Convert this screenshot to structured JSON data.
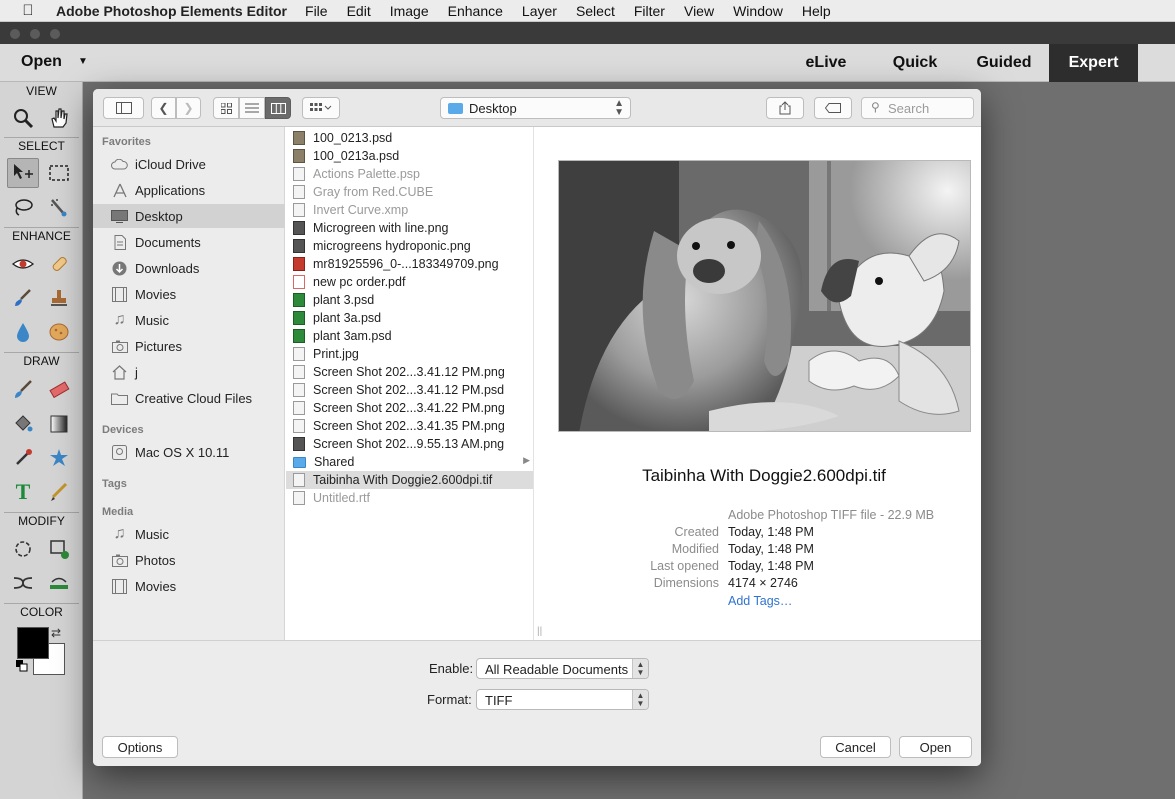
{
  "menubar": {
    "apple_icon": "apple-logo-icon",
    "app_name": "Adobe Photoshop Elements Editor",
    "items": [
      "File",
      "Edit",
      "Image",
      "Enhance",
      "Layer",
      "Select",
      "Filter",
      "View",
      "Window",
      "Help"
    ]
  },
  "appbar": {
    "open_label": "Open",
    "modes": [
      "eLive",
      "Quick",
      "Guided",
      "Expert"
    ],
    "active_mode": "Expert"
  },
  "toolbox": {
    "sections": [
      "VIEW",
      "SELECT",
      "ENHANCE",
      "DRAW",
      "MODIFY",
      "COLOR"
    ],
    "foreground_color": "#000000",
    "background_color": "#ffffff",
    "tools": {
      "view": [
        "zoom-tool-icon",
        "hand-tool-icon"
      ],
      "select": [
        "move-tool-icon",
        "marquee-tool-icon",
        "lasso-tool-icon",
        "quick-selection-tool-icon"
      ],
      "enhance": [
        "red-eye-tool-icon",
        "spot-healing-tool-icon",
        "smart-brush-tool-icon",
        "clone-stamp-tool-icon",
        "blur-tool-icon",
        "sponge-tool-icon"
      ],
      "draw": [
        "brush-tool-icon",
        "eraser-tool-icon",
        "paint-bucket-tool-icon",
        "gradient-tool-icon",
        "eyedropper-tool-icon",
        "custom-shape-tool-icon",
        "type-tool-icon",
        "pencil-tool-icon"
      ],
      "modify": [
        "crop-tool-icon",
        "recompose-tool-icon",
        "content-aware-move-tool-icon",
        "straighten-tool-icon"
      ]
    }
  },
  "dialog": {
    "location": "Desktop",
    "search_placeholder": "Search",
    "sidebar": {
      "sections": [
        {
          "heading": "Favorites",
          "items": [
            {
              "label": "iCloud Drive",
              "icon": "cloud-icon"
            },
            {
              "label": "Applications",
              "icon": "applications-icon"
            },
            {
              "label": "Desktop",
              "icon": "desktop-icon",
              "selected": true
            },
            {
              "label": "Documents",
              "icon": "documents-icon"
            },
            {
              "label": "Downloads",
              "icon": "downloads-icon"
            },
            {
              "label": "Movies",
              "icon": "movies-icon"
            },
            {
              "label": "Music",
              "icon": "music-icon"
            },
            {
              "label": "Pictures",
              "icon": "pictures-icon"
            },
            {
              "label": "j",
              "icon": "home-icon"
            },
            {
              "label": "Creative Cloud Files",
              "icon": "folder-icon"
            }
          ]
        },
        {
          "heading": "Devices",
          "items": [
            {
              "label": "Mac OS X 10.11",
              "icon": "disk-icon"
            }
          ]
        },
        {
          "heading": "Tags",
          "items": []
        },
        {
          "heading": "Media",
          "items": [
            {
              "label": "Music",
              "icon": "music-icon"
            },
            {
              "label": "Photos",
              "icon": "photos-icon"
            },
            {
              "label": "Movies",
              "icon": "movies-icon"
            }
          ]
        }
      ]
    },
    "files": [
      {
        "name": "100_0213.psd",
        "kind": "photo",
        "dim": false
      },
      {
        "name": "100_0213a.psd",
        "kind": "photo",
        "dim": false
      },
      {
        "name": "Actions Palette.psp",
        "kind": "doc",
        "dim": true
      },
      {
        "name": "Gray from Red.CUBE",
        "kind": "doc",
        "dim": true
      },
      {
        "name": "Invert Curve.xmp",
        "kind": "doc",
        "dim": true
      },
      {
        "name": "Microgreen with line.png",
        "kind": "dark",
        "dim": false
      },
      {
        "name": "microgreens hydroponic.png",
        "kind": "dark",
        "dim": false
      },
      {
        "name": "mr81925596_0-...183349709.png",
        "kind": "red",
        "dim": false
      },
      {
        "name": "new pc order.pdf",
        "kind": "pdf",
        "dim": false
      },
      {
        "name": "plant 3.psd",
        "kind": "green",
        "dim": false
      },
      {
        "name": "plant 3a.psd",
        "kind": "green",
        "dim": false
      },
      {
        "name": "plant 3am.psd",
        "kind": "green",
        "dim": false
      },
      {
        "name": "Print.jpg",
        "kind": "doc",
        "dim": false
      },
      {
        "name": "Screen Shot 202...3.41.12 PM.png",
        "kind": "doc",
        "dim": false
      },
      {
        "name": "Screen Shot 202...3.41.12 PM.psd",
        "kind": "doc",
        "dim": false
      },
      {
        "name": "Screen Shot 202...3.41.22 PM.png",
        "kind": "doc",
        "dim": false
      },
      {
        "name": "Screen Shot 202...3.41.35 PM.png",
        "kind": "doc",
        "dim": false
      },
      {
        "name": "Screen Shot 202...9.55.13 AM.png",
        "kind": "dark",
        "dim": false
      },
      {
        "name": "Shared",
        "kind": "folder",
        "dim": false,
        "has_children": true
      },
      {
        "name": "Taibinha With Doggie2.600dpi.tif",
        "kind": "doc",
        "dim": false,
        "selected": true
      },
      {
        "name": "Untitled.rtf",
        "kind": "doc",
        "dim": true
      }
    ],
    "preview": {
      "file_name": "Taibinha With Doggie2.600dpi.tif",
      "kind": "Adobe Photoshop TIFF file - 22.9 MB",
      "meta": [
        {
          "key": "Created",
          "value": "Today, 1:48 PM"
        },
        {
          "key": "Modified",
          "value": "Today, 1:48 PM"
        },
        {
          "key": "Last opened",
          "value": "Today, 1:48 PM"
        },
        {
          "key": "Dimensions",
          "value": "4174 × 2746"
        }
      ],
      "add_tags": "Add Tags…"
    },
    "enable_label": "Enable:",
    "enable_value": "All Readable Documents",
    "format_label": "Format:",
    "format_value": "TIFF",
    "options_button": "Options",
    "cancel_button": "Cancel",
    "open_button": "Open"
  }
}
